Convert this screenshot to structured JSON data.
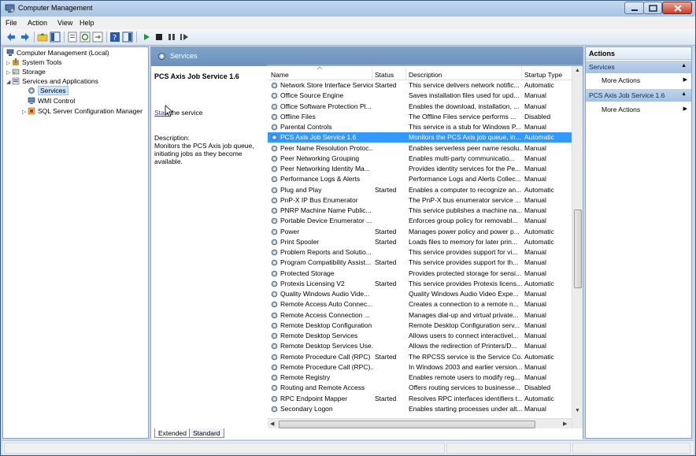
{
  "window": {
    "title": "Computer Management"
  },
  "menu": [
    "File",
    "Action",
    "View",
    "Help"
  ],
  "tree": {
    "items": [
      {
        "label": "Computer Management (Local)",
        "level": 0,
        "expander": "",
        "icon": "computer-icon"
      },
      {
        "label": "System Tools",
        "level": 1,
        "expander": "▷",
        "icon": "tools-icon"
      },
      {
        "label": "Storage",
        "level": 1,
        "expander": "▷",
        "icon": "storage-icon"
      },
      {
        "label": "Services and Applications",
        "level": 1,
        "expander": "◢",
        "icon": "services-apps-icon"
      },
      {
        "label": "Services",
        "level": 2,
        "expander": "",
        "icon": "services-icon",
        "selected": true
      },
      {
        "label": "WMI Control",
        "level": 2,
        "expander": "",
        "icon": "wmi-icon"
      },
      {
        "label": "SQL Server Configuration Manager",
        "level": 2,
        "expander": "▷",
        "icon": "sql-icon"
      }
    ]
  },
  "center": {
    "header_title": "Services",
    "service_title": "PCS Axis Job Service 1.6",
    "start_link": "Start",
    "start_suffix": " the service",
    "description_label": "Description:",
    "description_text": "Monitors the PCS Axis job queue, initiating jobs as they become available.",
    "columns": [
      "Name",
      "Status",
      "Description",
      "Startup Type"
    ],
    "tabs": [
      "Extended",
      "Standard"
    ]
  },
  "services": [
    {
      "name": "Network Store Interface Service",
      "status": "Started",
      "desc": "This service delivers network notific...",
      "startup": "Automatic"
    },
    {
      "name": "Office  Source Engine",
      "status": "",
      "desc": "Saves installation files used for upd...",
      "startup": "Manual"
    },
    {
      "name": "Office Software Protection Pl...",
      "status": "",
      "desc": "Enables the download, installation, ...",
      "startup": "Manual"
    },
    {
      "name": "Offline Files",
      "status": "",
      "desc": "The Offline Files service performs ...",
      "startup": "Disabled"
    },
    {
      "name": "Parental Controls",
      "status": "",
      "desc": "This service is a stub for Windows P...",
      "startup": "Manual"
    },
    {
      "name": "PCS Axis Job Service 1.6",
      "status": "",
      "desc": "Monitors the PCS Axis job queue, in...",
      "startup": "Automatic",
      "selected": true
    },
    {
      "name": "Peer Name Resolution Protoc...",
      "status": "",
      "desc": "Enables serverless peer name resolu...",
      "startup": "Manual"
    },
    {
      "name": "Peer Networking Grouping",
      "status": "",
      "desc": "Enables multi-party communicatio...",
      "startup": "Manual"
    },
    {
      "name": "Peer Networking Identity Ma...",
      "status": "",
      "desc": "Provides identity services for the Pe...",
      "startup": "Manual"
    },
    {
      "name": "Performance Logs & Alerts",
      "status": "",
      "desc": "Performance Logs and Alerts Collec...",
      "startup": "Manual"
    },
    {
      "name": "Plug and Play",
      "status": "Started",
      "desc": "Enables a computer to recognize an...",
      "startup": "Automatic"
    },
    {
      "name": "PnP-X IP Bus Enumerator",
      "status": "",
      "desc": "The PnP-X bus enumerator service ...",
      "startup": "Manual"
    },
    {
      "name": "PNRP Machine Name Public...",
      "status": "",
      "desc": "This service publishes a machine na...",
      "startup": "Manual"
    },
    {
      "name": "Portable Device Enumerator ...",
      "status": "",
      "desc": "Enforces group policy for removabl...",
      "startup": "Manual"
    },
    {
      "name": "Power",
      "status": "Started",
      "desc": "Manages power policy and power p...",
      "startup": "Automatic"
    },
    {
      "name": "Print Spooler",
      "status": "Started",
      "desc": "Loads files to memory for later prin...",
      "startup": "Automatic"
    },
    {
      "name": "Problem Reports and Solutio...",
      "status": "",
      "desc": "This service provides support for vi...",
      "startup": "Manual"
    },
    {
      "name": "Program Compatibility Assist...",
      "status": "Started",
      "desc": "This service provides support for th...",
      "startup": "Manual"
    },
    {
      "name": "Protected Storage",
      "status": "",
      "desc": "Provides protected storage for sensi...",
      "startup": "Manual"
    },
    {
      "name": "Protexis Licensing V2",
      "status": "Started",
      "desc": "This service provides Protexis licens...",
      "startup": "Automatic"
    },
    {
      "name": "Quality Windows Audio Vide...",
      "status": "",
      "desc": "Quality Windows Audio Video Expe...",
      "startup": "Manual"
    },
    {
      "name": "Remote Access Auto Connec...",
      "status": "",
      "desc": "Creates a connection to a remote n...",
      "startup": "Manual"
    },
    {
      "name": "Remote Access Connection ...",
      "status": "",
      "desc": "Manages dial-up and virtual private...",
      "startup": "Manual"
    },
    {
      "name": "Remote Desktop Configuration",
      "status": "",
      "desc": "Remote Desktop Configuration serv...",
      "startup": "Manual"
    },
    {
      "name": "Remote Desktop Services",
      "status": "",
      "desc": "Allows users to connect interactivel...",
      "startup": "Manual"
    },
    {
      "name": "Remote Desktop Services Use...",
      "status": "",
      "desc": "Allows the redirection of Printers/D...",
      "startup": "Manual"
    },
    {
      "name": "Remote Procedure Call (RPC)",
      "status": "Started",
      "desc": "The RPCSS service is the Service Co...",
      "startup": "Automatic"
    },
    {
      "name": "Remote Procedure Call (RPC)...",
      "status": "",
      "desc": "In Windows 2003 and earlier version...",
      "startup": "Manual"
    },
    {
      "name": "Remote Registry",
      "status": "",
      "desc": "Enables remote users to modify reg...",
      "startup": "Manual"
    },
    {
      "name": "Routing and Remote Access",
      "status": "",
      "desc": "Offers routing services to businesse...",
      "startup": "Disabled"
    },
    {
      "name": "RPC Endpoint Mapper",
      "status": "Started",
      "desc": "Resolves RPC interfaces identifiers t...",
      "startup": "Automatic"
    },
    {
      "name": "Secondary Logon",
      "status": "",
      "desc": "Enables starting processes under alt...",
      "startup": "Manual"
    }
  ],
  "actions": {
    "header": "Actions",
    "sections": [
      {
        "label": "Services",
        "items": [
          "More Actions"
        ]
      },
      {
        "label": "PCS Axis Job Service 1.6",
        "items": [
          "More Actions"
        ]
      }
    ]
  },
  "colors": {
    "selection": "#3399ff",
    "header_blue": "#6c92bd",
    "link": "#3a3aa0"
  }
}
